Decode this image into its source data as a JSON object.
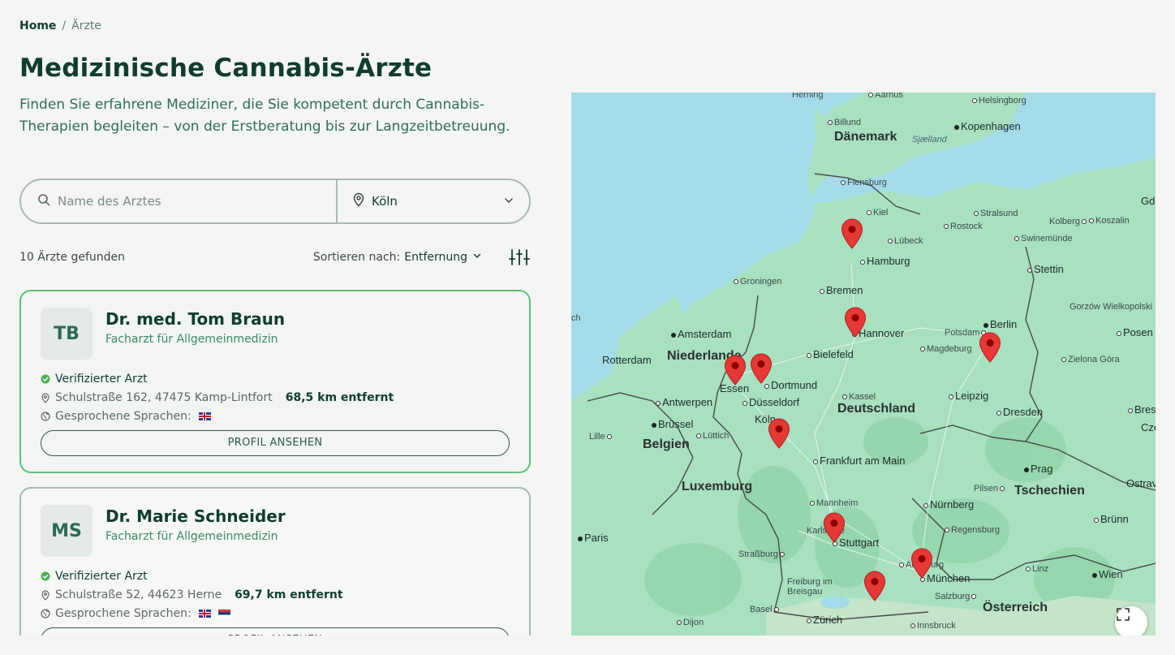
{
  "breadcrumb": {
    "home": "Home",
    "separator": "/",
    "current": "Ärzte"
  },
  "page": {
    "title": "Medizinische Cannabis-Ärzte",
    "subtitle": "Finden Sie erfahrene Mediziner, die Sie kompetent durch Cannabis-Therapien begleiten – von der Erstberatung bis zur Langzeitbetreuung."
  },
  "search": {
    "name_placeholder": "Name des Arztes",
    "name_value": "",
    "location_value": "Köln",
    "search_icon": "search-icon",
    "location_icon": "location-pin-icon"
  },
  "results": {
    "count_text": "10 Ärzte gefunden",
    "sort_label": "Sortieren nach:",
    "sort_value": "Entfernung",
    "filter_icon": "sliders-icon"
  },
  "doctors": [
    {
      "initials": "TB",
      "name": "Dr. med. Tom Braun",
      "specialty": "Facharzt für Allgemeinmedizin",
      "verified": "Verifizierter Arzt",
      "address": "Schulstraße 162, 47475 Kamp-Lintfort",
      "distance": "68,5 km entfernt",
      "languages_label": "Gesprochene Sprachen:",
      "languages": [
        "English"
      ],
      "button": "PROFIL ANSEHEN"
    },
    {
      "initials": "MS",
      "name": "Dr. Marie Schneider",
      "specialty": "Facharzt für Allgemeinmedizin",
      "verified": "Verifizierter Arzt",
      "address": "Schulstraße 52, 44623 Herne",
      "distance": "69,7 km entfernt",
      "languages_label": "Gesprochene Sprachen:",
      "languages": [
        "English",
        "Serbian"
      ],
      "button": "PROFIL ANSEHEN"
    }
  ],
  "map": {
    "labels": {
      "herning": "Herning",
      "aarhus": "Aarhus",
      "helsingborg": "Helsingborg",
      "billund": "Billund",
      "kopenhagen": "Kopenhagen",
      "daenemark": "Dänemark",
      "sjaelland": "Sjælland",
      "flensburg": "Flensburg",
      "kiel": "Kiel",
      "stralsund": "Stralsund",
      "rostock": "Rostock",
      "kolberg": "Kolberg",
      "koszalin": "Koszalin",
      "luebeck": "Lübeck",
      "swinemuende": "Swinemünde",
      "hamburg": "Hamburg",
      "stettin": "Stettin",
      "groningen": "Groningen",
      "bremen": "Bremen",
      "gorzow": "Gorzów Wielkopolski",
      "amsterdam": "Amsterdam",
      "hannover": "Hannover",
      "potsdam": "Potsdam",
      "berlin": "Berlin",
      "posen": "Posen",
      "rotterdam": "Rotterdam",
      "niederlande": "Niederlande",
      "bielefeld": "Bielefeld",
      "magdeburg": "Magdeburg",
      "zielona": "Zielona Góra",
      "dortmund": "Dortmund",
      "essen": "Essen",
      "kassel": "Kassel",
      "antwerpen": "Antwerpen",
      "duesseldorf": "Düsseldorf",
      "deutschland": "Deutschland",
      "leipzig": "Leipzig",
      "breslau": "Bresla",
      "bruessel": "Brüssel",
      "koeln": "Köln",
      "dresden": "Dresden",
      "czest": "Częst",
      "lille": "Lille",
      "luettich": "Lüttich",
      "belgien": "Belgien",
      "frankfurt": "Frankfurt am Main",
      "prag": "Prag",
      "luxemburg": "Luxemburg",
      "pilsen": "Pilsen",
      "tschechien": "Tschechien",
      "ostrava": "Ostrav",
      "mannheim": "Mannheim",
      "nuernberg": "Nürnberg",
      "bruenn": "Brünn",
      "paris": "Paris",
      "karlsruhe": "Karlsruhe",
      "regensburg": "Regensburg",
      "stuttgart": "Stuttgart",
      "strassburg": "Straßburg",
      "augsburg": "Augsburg",
      "linz": "Linz",
      "muenchen": "München",
      "wien": "Wien",
      "freiburg": "Freiburg im Breisgau",
      "salzburg": "Salzburg",
      "basel": "Basel",
      "oesterreich": "Österreich",
      "dijon": "Dijon",
      "zuerich": "Zürich",
      "innsbruck": "Innsbruck",
      "gd": "Gd",
      "ch": "ch"
    },
    "marker_count": 9,
    "marker_color": "#e53935",
    "expand_icon": "fullscreen-icon"
  },
  "colors": {
    "primary": "#0f3d2e",
    "accent": "#3a8a68",
    "selected_border": "#5bc27c",
    "verified": "#4caf50"
  }
}
